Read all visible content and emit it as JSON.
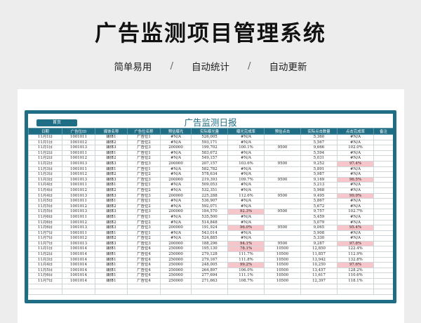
{
  "page": {
    "title": "广告监测项目管理系统",
    "subtitles": [
      "简单易用",
      "自动统计",
      "自动更新"
    ],
    "separator": "/"
  },
  "sheet": {
    "home_button": "首页",
    "title": "广告监测日报",
    "columns": [
      "日期",
      "广告位ID",
      "媒体名称",
      "广告位名称",
      "预估曝光",
      "实际曝光量",
      "曝光完成率",
      "预估点击",
      "实际点击数量",
      "点击完成率",
      "备注"
    ],
    "highlight_color": "#f6c6cb",
    "rows": [
      {
        "cells": [
          "11月1日",
          "1001011",
          "媒体1",
          "广告位1",
          "#N/A",
          "526,005",
          "#N/A",
          "",
          "5,360",
          "#N/A",
          ""
        ],
        "hl": []
      },
      {
        "cells": [
          "11月1日",
          "1001012",
          "媒体2",
          "广告位2",
          "#N/A",
          "593,171",
          "#N/A",
          "",
          "5,567",
          "#N/A",
          ""
        ],
        "hl": []
      },
      {
        "cells": [
          "11月1日",
          "1001013",
          "媒体3",
          "广告位3",
          "200000",
          "199,702",
          "100.1%",
          "9500",
          "9,666",
          "102.0%",
          ""
        ],
        "hl": []
      },
      {
        "cells": [
          "11月2日",
          "1001011",
          "媒体1",
          "广告位1",
          "#N/A",
          "583,672",
          "#N/A",
          "",
          "5,594",
          "#N/A",
          ""
        ],
        "hl": []
      },
      {
        "cells": [
          "11月2日",
          "1001012",
          "媒体2",
          "广告位2",
          "#N/A",
          "549,157",
          "#N/A",
          "",
          "5,031",
          "#N/A",
          ""
        ],
        "hl": []
      },
      {
        "cells": [
          "11月2日",
          "1001013",
          "媒体3",
          "广告位3",
          "200000",
          "207,157",
          "103.6%",
          "9500",
          "9,252",
          "97.4%",
          ""
        ],
        "hl": [
          9
        ]
      },
      {
        "cells": [
          "11月3日",
          "1001011",
          "媒体1",
          "广告位1",
          "#N/A",
          "582,782",
          "#N/A",
          "",
          "5,891",
          "#N/A",
          ""
        ],
        "hl": []
      },
      {
        "cells": [
          "11月3日",
          "1001012",
          "媒体2",
          "广告位2",
          "#N/A",
          "578,634",
          "#N/A",
          "",
          "5,987",
          "#N/A",
          ""
        ],
        "hl": []
      },
      {
        "cells": [
          "11月3日",
          "1001013",
          "媒体3",
          "广告位3",
          "200000",
          "219,393",
          "109.7%",
          "9500",
          "9,169",
          "96.5%",
          ""
        ],
        "hl": [
          9
        ]
      },
      {
        "cells": [
          "11月4日",
          "1001011",
          "媒体1",
          "广告位1",
          "#N/A",
          "509,053",
          "#N/A",
          "",
          "5,213",
          "#N/A",
          ""
        ],
        "hl": []
      },
      {
        "cells": [
          "11月4日",
          "1001012",
          "媒体2",
          "广告位2",
          "#N/A",
          "532,351",
          "#N/A",
          "",
          "5,968",
          "#N/A",
          ""
        ],
        "hl": []
      },
      {
        "cells": [
          "11月4日",
          "1001013",
          "媒体3",
          "广告位3",
          "200000",
          "225,288",
          "112.6%",
          "9500",
          "9,495",
          "99.9%",
          ""
        ],
        "hl": [
          9
        ]
      },
      {
        "cells": [
          "11月5日",
          "1001011",
          "媒体1",
          "广告位1",
          "#N/A",
          "536,907",
          "#N/A",
          "",
          "5,867",
          "#N/A",
          ""
        ],
        "hl": []
      },
      {
        "cells": [
          "11月5日",
          "1001012",
          "媒体2",
          "广告位2",
          "#N/A",
          "592,071",
          "#N/A",
          "",
          "5,672",
          "#N/A",
          ""
        ],
        "hl": []
      },
      {
        "cells": [
          "11月5日",
          "1001013",
          "媒体3",
          "广告位3",
          "200000",
          "184,570",
          "92.3%",
          "9500",
          "9,757",
          "102.7%",
          ""
        ],
        "hl": [
          6
        ]
      },
      {
        "cells": [
          "11月6日",
          "1001011",
          "媒体1",
          "广告位1",
          "#N/A",
          "535,500",
          "#N/A",
          "",
          "5,459",
          "#N/A",
          ""
        ],
        "hl": []
      },
      {
        "cells": [
          "11月6日",
          "1001012",
          "媒体2",
          "广告位2",
          "#N/A",
          "514,848",
          "#N/A",
          "",
          "5,079",
          "#N/A",
          ""
        ],
        "hl": []
      },
      {
        "cells": [
          "11月6日",
          "1001013",
          "媒体3",
          "广告位3",
          "200000",
          "191,924",
          "96.0%",
          "9500",
          "9,065",
          "95.4%",
          ""
        ],
        "hl": [
          6,
          9
        ]
      },
      {
        "cells": [
          "11月7日",
          "1001011",
          "媒体1",
          "广告位1",
          "#N/A",
          "543,014",
          "#N/A",
          "",
          "5,908",
          "#N/A",
          ""
        ],
        "hl": []
      },
      {
        "cells": [
          "11月7日",
          "1001012",
          "媒体2",
          "广告位2",
          "#N/A",
          "524,885",
          "#N/A",
          "",
          "5,330",
          "#N/A",
          ""
        ],
        "hl": []
      },
      {
        "cells": [
          "11月7日",
          "1001013",
          "媒体3",
          "广告位3",
          "200000",
          "188,296",
          "94.1%",
          "9500",
          "9,287",
          "97.8%",
          ""
        ],
        "hl": [
          6,
          9
        ]
      },
      {
        "cells": [
          "11月1日",
          "1001014",
          "媒体1",
          "广告位4",
          "250000",
          "195,130",
          "78.1%",
          "10500",
          "12,850",
          "122.4%",
          ""
        ],
        "hl": [
          6
        ]
      },
      {
        "cells": [
          "11月2日",
          "1001014",
          "媒体1",
          "广告位4",
          "250000",
          "279,128",
          "111.7%",
          "10500",
          "11,857",
          "112.9%",
          ""
        ],
        "hl": []
      },
      {
        "cells": [
          "11月3日",
          "1001014",
          "媒体1",
          "广告位4",
          "250000",
          "279,167",
          "111.8%",
          "10500",
          "13,942",
          "132.8%",
          ""
        ],
        "hl": []
      },
      {
        "cells": [
          "11月4日",
          "1001014",
          "媒体1",
          "广告位4",
          "250000",
          "248,005",
          "99.2%",
          "10500",
          "10,250",
          "97.6%",
          ""
        ],
        "hl": [
          6,
          9
        ]
      },
      {
        "cells": [
          "11月5日",
          "1001014",
          "媒体1",
          "广告位4",
          "250000",
          "264,897",
          "106.0%",
          "10500",
          "13,457",
          "128.2%",
          ""
        ],
        "hl": []
      },
      {
        "cells": [
          "11月6日",
          "1001014",
          "媒体1",
          "广告位4",
          "250000",
          "277,694",
          "111.1%",
          "10500",
          "11,617",
          "110.6%",
          ""
        ],
        "hl": []
      },
      {
        "cells": [
          "11月7日",
          "1001014",
          "媒体1",
          "广告位4",
          "250000",
          "271,663",
          "108.7%",
          "10500",
          "12,397",
          "118.1%",
          ""
        ],
        "hl": []
      },
      {
        "cells": [
          "",
          "",
          "",
          "",
          "",
          "",
          "",
          "",
          "",
          "",
          ""
        ],
        "hl": []
      },
      {
        "cells": [
          "",
          "",
          "",
          "",
          "",
          "",
          "",
          "",
          "",
          "",
          ""
        ],
        "hl": []
      }
    ]
  }
}
